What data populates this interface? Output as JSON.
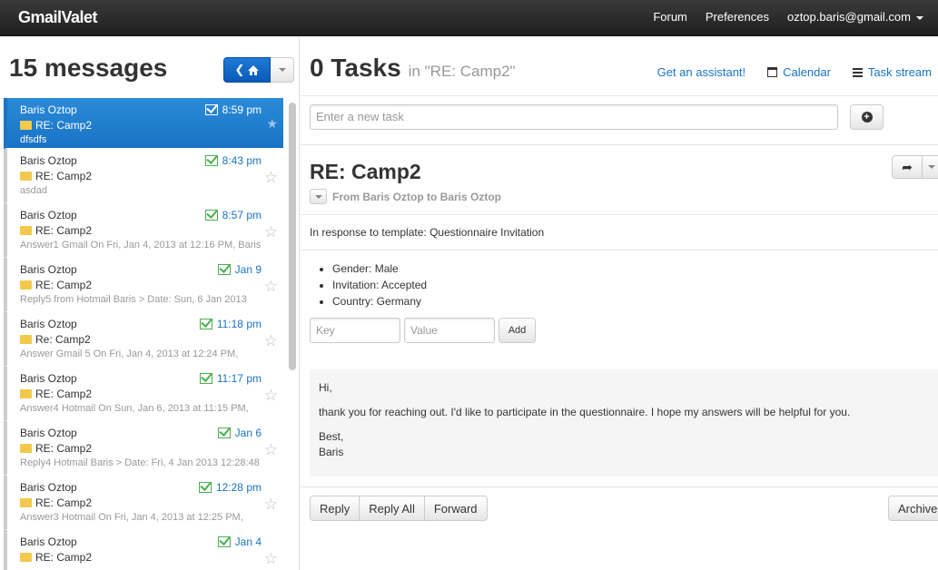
{
  "nav": {
    "brand": "GmailValet",
    "forum": "Forum",
    "preferences": "Preferences",
    "account": "oztop.baris@gmail.com"
  },
  "left": {
    "title": "15 messages",
    "messages": [
      {
        "sender": "Baris Oztop",
        "subject": "RE: Camp2",
        "snippet": "dfsdfs",
        "time": "8:59 pm",
        "selected": true
      },
      {
        "sender": "Baris Oztop",
        "subject": "RE: Camp2",
        "snippet": "asdad",
        "time": "8:43 pm"
      },
      {
        "sender": "Baris Oztop",
        "subject": "RE: Camp2",
        "snippet": "Answer1 Gmail On Fri, Jan 4, 2013 at 12:16 PM, Baris",
        "time": "8:57 pm"
      },
      {
        "sender": "Baris Oztop",
        "subject": "RE: Camp2",
        "snippet": "Reply5 from Hotmail Baris > Date: Sun, 6 Jan 2013",
        "time": "Jan 9"
      },
      {
        "sender": "Baris Oztop",
        "subject": "Re: Camp2",
        "snippet": "Answer Gmail 5 On Fri, Jan 4, 2013 at 12:24 PM,",
        "time": "11:18 pm"
      },
      {
        "sender": "Baris Oztop",
        "subject": "RE: Camp2",
        "snippet": "Answer4 Hotmail On Sun, Jan 6, 2013 at 11:15 PM,",
        "time": "11:17 pm"
      },
      {
        "sender": "Baris Oztop",
        "subject": "RE: Camp2",
        "snippet": "Reply4 Hotmail Baris > Date: Fri, 4 Jan 2013 12:28:48",
        "time": "Jan 6"
      },
      {
        "sender": "Baris Oztop",
        "subject": "RE: Camp2",
        "snippet": "Answer3 Hotmail On Fri, Jan 4, 2013 at 12:25 PM,",
        "time": "12:28 pm"
      },
      {
        "sender": "Baris Oztop",
        "subject": "RE: Camp2",
        "snippet": "",
        "time": "Jan 4"
      }
    ]
  },
  "right": {
    "task_count": "0 Tasks",
    "task_context": "in \"RE: Camp2\"",
    "get_assistant": "Get an assistant!",
    "calendar": "Calendar",
    "task_stream": "Task stream",
    "task_placeholder": "Enter a new task",
    "email": {
      "subject": "RE: Camp2",
      "from_line": "From Baris Oztop to Baris Oztop",
      "template": "In response to template: Questionnaire Invitation",
      "properties": [
        "Gender: Male",
        "Invitation: Accepted",
        "Country: Germany"
      ],
      "key_placeholder": "Key",
      "value_placeholder": "Value",
      "add_label": "Add",
      "body": {
        "greeting": "Hi,",
        "line1": "thank you for reaching out. I'd like to participate in the questionnaire. I hope my answers will be helpful for you.",
        "closing": "Best,",
        "signature": "Baris"
      }
    },
    "actions": {
      "reply": "Reply",
      "reply_all": "Reply All",
      "forward": "Forward",
      "archive": "Archive"
    }
  }
}
